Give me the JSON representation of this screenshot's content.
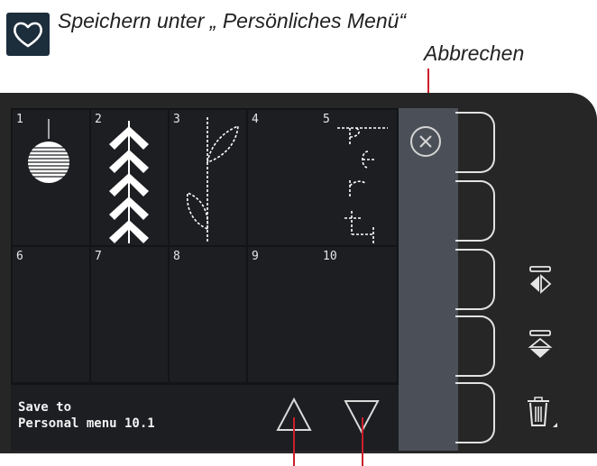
{
  "annotations": {
    "title": "Speichern unter „ Persönliches Menü“",
    "cancel_label": "Abbrechen"
  },
  "menu": {
    "cells": [
      {
        "number": "1",
        "stitch": "sphere"
      },
      {
        "number": "2",
        "stitch": "chevrons"
      },
      {
        "number": "3",
        "stitch": "leaf"
      },
      {
        "number": "4",
        "stitch": ""
      },
      {
        "number": "5",
        "stitch": "text-perf"
      },
      {
        "number": "6",
        "stitch": ""
      },
      {
        "number": "7",
        "stitch": ""
      },
      {
        "number": "8",
        "stitch": ""
      },
      {
        "number": "9",
        "stitch": ""
      },
      {
        "number": "10",
        "stitch": ""
      }
    ],
    "save_line1": "Save to",
    "save_line2": "Personal menu 10.1",
    "scroll_up_icon": "triangle-up-icon",
    "scroll_down_icon": "triangle-down-icon",
    "cancel_icon": "close-circle-icon"
  },
  "side_buttons": [
    {
      "icon": "",
      "name": "side-key-1"
    },
    {
      "icon": "",
      "name": "side-key-2"
    },
    {
      "icon": "mirror-side-to-side-icon",
      "name": "side-key-3"
    },
    {
      "icon": "mirror-end-to-end-icon",
      "name": "side-key-4"
    },
    {
      "icon": "trash-icon",
      "name": "side-key-5"
    }
  ],
  "colors": {
    "annotation_line": "#cc1f2b",
    "screen_bg": "#121416",
    "sidebar_bg": "#4b5058",
    "heart_box": "#1c2d3c"
  }
}
